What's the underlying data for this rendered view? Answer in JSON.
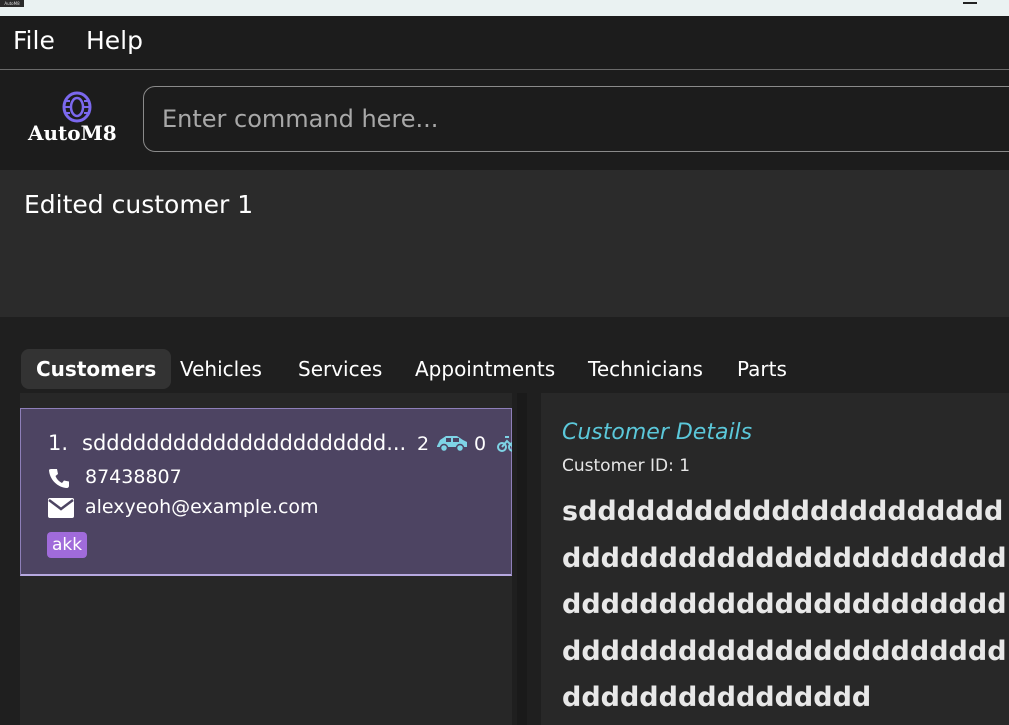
{
  "window": {
    "icon_text": "AutoM8"
  },
  "menu": {
    "file": "File",
    "help": "Help"
  },
  "logo": {
    "text": "AutoM8"
  },
  "command": {
    "placeholder": "Enter command here..."
  },
  "result": {
    "message": "Edited customer 1"
  },
  "tabs": [
    {
      "label": "Customers",
      "active": true
    },
    {
      "label": "Vehicles"
    },
    {
      "label": "Services"
    },
    {
      "label": "Appointments"
    },
    {
      "label": "Technicians"
    },
    {
      "label": "Parts"
    }
  ],
  "customer_list": [
    {
      "index": "1.",
      "name": "sdddddddddddddddddddddd...",
      "vehicle_count": "2",
      "service_count": "0",
      "phone": "87438807",
      "email": "alexyeoh@example.com",
      "tags": [
        "akk"
      ]
    }
  ],
  "details": {
    "title": "Customer Details",
    "id_line": "Customer ID: 1",
    "name": "sddddddddddddddddddddddddddddddddddddddddddddddddddddddddddddddddddddddddddddddddddddddddddddddddddddddddddd"
  },
  "colors": {
    "accent": "#5bc8da",
    "selected_card": "#4d4462",
    "tag": "#a06bda"
  },
  "icons": [
    "logo-tyre-icon",
    "car-icon",
    "bike-icon",
    "phone-icon",
    "email-icon",
    "minimize-icon"
  ]
}
